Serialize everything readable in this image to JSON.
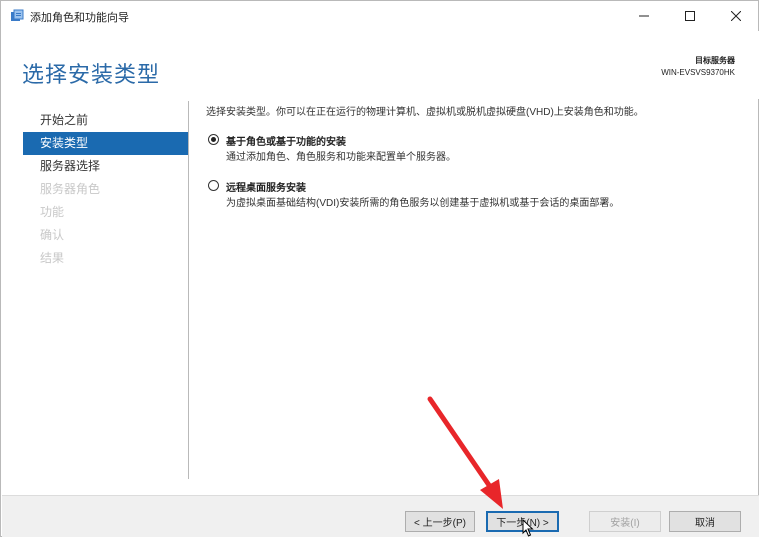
{
  "window": {
    "title": "添加角色和功能向导"
  },
  "header": {
    "page_title": "选择安装类型",
    "dest_label": "目标服务器",
    "dest_server": "WIN-EVSVS9370HK"
  },
  "nav": {
    "items": [
      {
        "label": "开始之前",
        "state": "normal"
      },
      {
        "label": "安装类型",
        "state": "active"
      },
      {
        "label": "服务器选择",
        "state": "normal"
      },
      {
        "label": "服务器角色",
        "state": "disabled"
      },
      {
        "label": "功能",
        "state": "disabled"
      },
      {
        "label": "确认",
        "state": "disabled"
      },
      {
        "label": "结果",
        "state": "disabled"
      }
    ]
  },
  "content": {
    "intro": "选择安装类型。你可以在正在运行的物理计算机、虚拟机或脱机虚拟硬盘(VHD)上安装角色和功能。",
    "options": [
      {
        "title": "基于角色或基于功能的安装",
        "desc": "通过添加角色、角色服务和功能来配置单个服务器。",
        "selected": true
      },
      {
        "title": "远程桌面服务安装",
        "desc": "为虚拟桌面基础结构(VDI)安装所需的角色服务以创建基于虚拟机或基于会话的桌面部署。",
        "selected": false
      }
    ]
  },
  "footer": {
    "prev_label": "< 上一步(P)",
    "next_label": "下一步(N) >",
    "install_label": "安装(I)",
    "cancel_label": "取消"
  },
  "colors": {
    "accent": "#1a6ab1",
    "title": "#2b6aa8",
    "annotation_arrow": "#e8262a"
  },
  "icons": {
    "app": "server-manager-icon",
    "annotation": "red-arrow",
    "cursor": "mouse-pointer-icon"
  }
}
